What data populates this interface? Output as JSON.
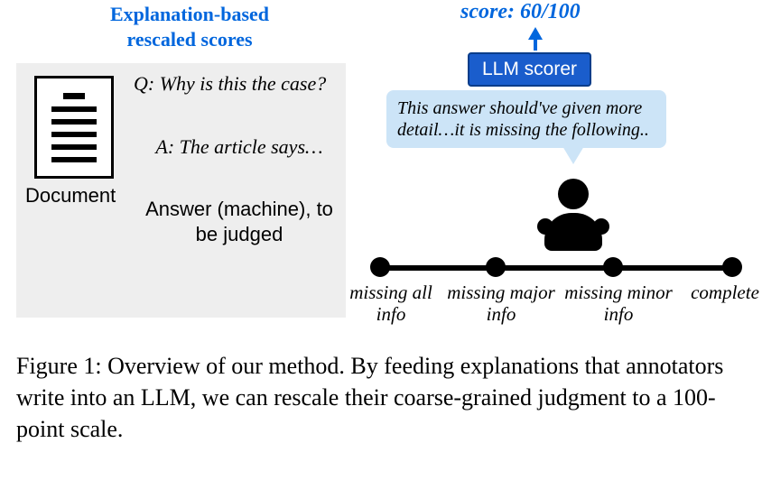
{
  "title": "Explanation-based rescaled scores",
  "left": {
    "document_label": "Document",
    "q": "Q: Why is this the case?",
    "a": "A: The article says…",
    "answer": "Answer (machine), to be judged"
  },
  "right": {
    "score": "score: 60/100",
    "llm_scorer": "LLM scorer",
    "bubble": "This answer should've given more detail…it is missing the following.."
  },
  "scale": {
    "l1": "missing all info",
    "l2": "missing major info",
    "l3": "missing minor info",
    "l4": "complete"
  },
  "caption": "Figure 1: Overview of our method. By feeding explanations that annotators write into an LLM, we can rescale their coarse-grained judgment to a 100-point scale."
}
